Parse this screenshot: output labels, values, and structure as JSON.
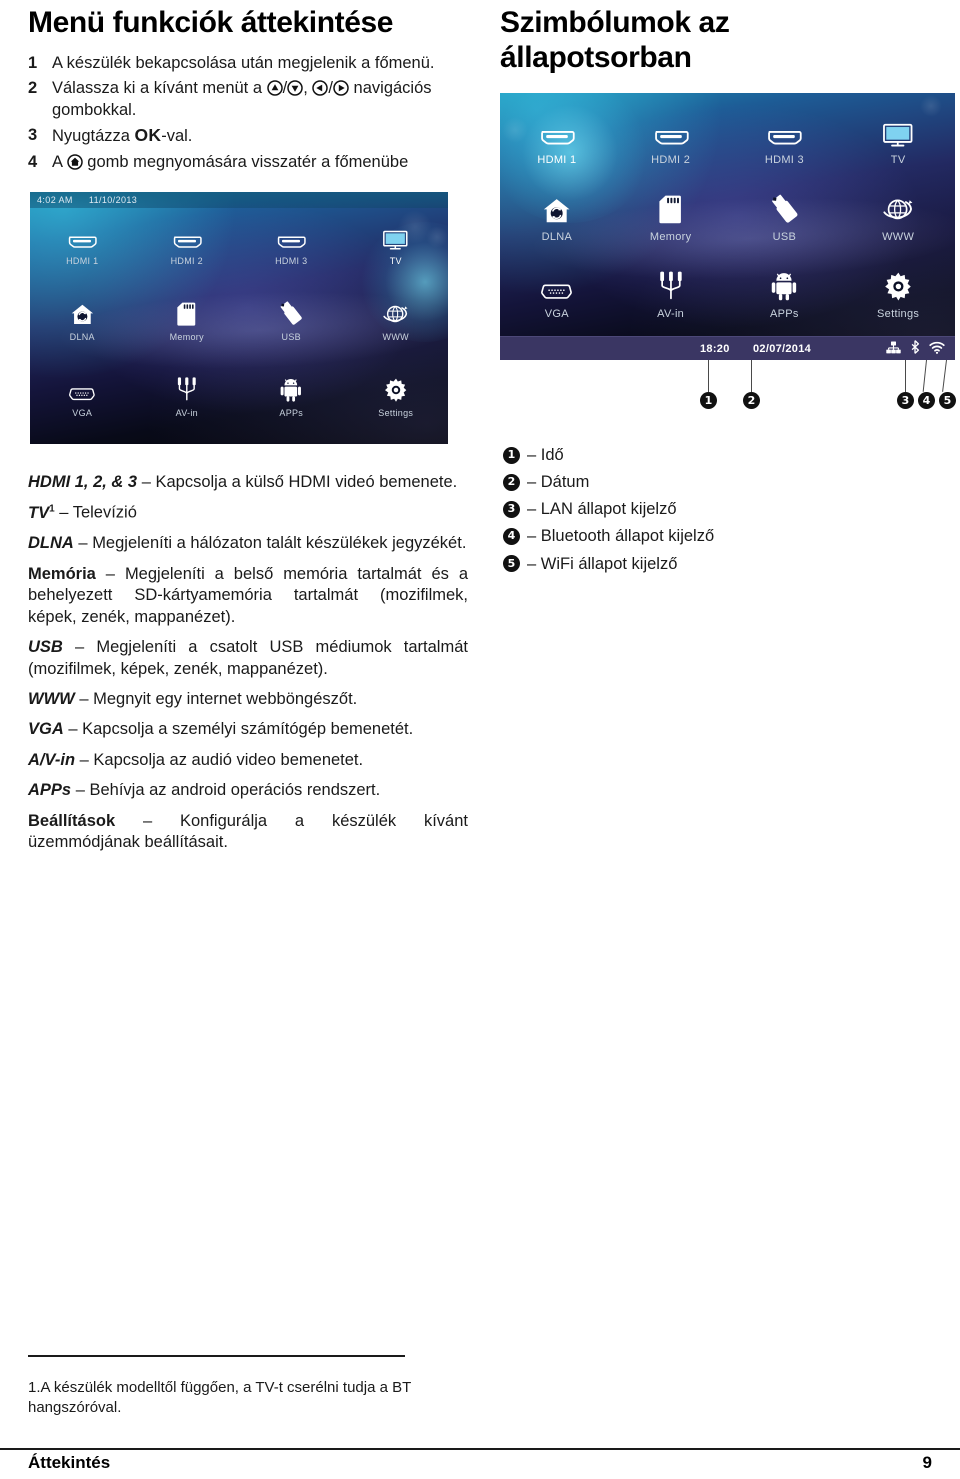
{
  "left_column": {
    "title": "Menü funkciók áttekintése",
    "steps": [
      {
        "num": "1",
        "text_before": "A készülék bekapcsolása után megjelenik a főmenü.",
        "icons": []
      },
      {
        "num": "2",
        "part1": "Válassza ki a kívánt menüt a ",
        "sep1": "/",
        "sep2": ", ",
        "sep3": "/",
        "part2": " navigációs gombokkal.",
        "icons": [
          "arrow-up-button-icon",
          "arrow-down-button-icon",
          "arrow-left-button-icon",
          "arrow-right-button-icon"
        ]
      },
      {
        "num": "3",
        "part1": "Nyugtázza ",
        "bold": "OK",
        "part2": "-val."
      },
      {
        "num": "4",
        "part1": "A ",
        "part2": " gomb megnyomására visszatér a főmenübe",
        "icons": [
          "home-button-icon"
        ]
      }
    ],
    "screenshot": {
      "name": "projector-main-menu-screenshot-left",
      "status_time": "4:02 AM",
      "status_date": "11/10/2013",
      "active_tile": "TV",
      "tiles": [
        {
          "label": "HDMI 1",
          "icon": "hdmi-port-icon"
        },
        {
          "label": "HDMI 2",
          "icon": "hdmi-port-icon"
        },
        {
          "label": "HDMI 3",
          "icon": "hdmi-port-icon"
        },
        {
          "label": "TV",
          "icon": "television-icon"
        },
        {
          "label": "DLNA",
          "icon": "dlna-house-share-icon"
        },
        {
          "label": "Memory",
          "icon": "sd-card-icon"
        },
        {
          "label": "USB",
          "icon": "usb-stick-icon"
        },
        {
          "label": "WWW",
          "icon": "globe-browser-icon"
        },
        {
          "label": "VGA",
          "icon": "vga-port-icon"
        },
        {
          "label": "AV-in",
          "icon": "av-cable-icon"
        },
        {
          "label": "APPs",
          "icon": "android-robot-icon"
        },
        {
          "label": "Settings",
          "icon": "gear-icon"
        }
      ]
    },
    "body": [
      {
        "term": "HDMI 1, 2, & 3",
        "style": "bold-italic",
        "sup": "",
        "dash": " – ",
        "text": "Kapcsolja a külső HDMI videó bemenete."
      },
      {
        "term": "TV",
        "style": "bold-italic",
        "sup": "1",
        "dash": " – ",
        "text": "Televízió"
      },
      {
        "term": "DLNA",
        "style": "bold-italic",
        "sup": "",
        "dash": " – ",
        "text": "Megjeleníti a hálózaton talált készülékek jegyzékét."
      },
      {
        "term": "Memória",
        "style": "bold",
        "sup": "",
        "dash": " – ",
        "text": "Megjeleníti a belső memória tartalmát és a behelyezett SD-kártyamemória tartalmát (mozifilmek, képek, zenék, mappanézet)."
      },
      {
        "term": "USB",
        "style": "bold-italic",
        "sup": "",
        "dash": " – ",
        "text": "Megjeleníti a csatolt USB médiumok tartalmát (mozifilmek, képek, zenék, mappanézet)."
      },
      {
        "term": "WWW",
        "style": "bold-italic",
        "sup": "",
        "dash": " – ",
        "text": "Megnyit egy internet webböngészőt."
      },
      {
        "term": "VGA",
        "style": "bold-italic",
        "sup": "",
        "dash": " – ",
        "text": "Kapcsolja a személyi számítógép bemenetét."
      },
      {
        "term": "A/V-in",
        "style": "bold-italic",
        "sup": "",
        "dash": " – ",
        "text": "Kapcsolja az audió video bemenetet."
      },
      {
        "term": "APPs",
        "style": "bold-italic",
        "sup": "",
        "dash": " – ",
        "text": "Behívja az android operációs rendszert."
      },
      {
        "term": "Beállítások",
        "style": "bold",
        "sup": "",
        "dash": " – ",
        "text": "Konfigurálja a készülék kívánt üzemmódjának beállításait."
      }
    ]
  },
  "right_column": {
    "title": "Szimbólumok az állapotsorban",
    "screenshot": {
      "name": "projector-main-menu-screenshot-right",
      "status_time": "18:20",
      "status_date": "02/07/2014",
      "active_tile": "HDMI 1",
      "status_icons": [
        "lan-status-icon",
        "bluetooth-status-icon",
        "wifi-status-icon"
      ],
      "tiles": [
        {
          "label": "HDMI 1",
          "icon": "hdmi-port-icon"
        },
        {
          "label": "HDMI 2",
          "icon": "hdmi-port-icon"
        },
        {
          "label": "HDMI 3",
          "icon": "hdmi-port-icon"
        },
        {
          "label": "TV",
          "icon": "television-icon"
        },
        {
          "label": "DLNA",
          "icon": "dlna-house-share-icon"
        },
        {
          "label": "Memory",
          "icon": "sd-card-icon"
        },
        {
          "label": "USB",
          "icon": "usb-stick-icon"
        },
        {
          "label": "WWW",
          "icon": "globe-browser-icon"
        },
        {
          "label": "VGA",
          "icon": "vga-port-icon"
        },
        {
          "label": "AV-in",
          "icon": "av-cable-icon"
        },
        {
          "label": "APPs",
          "icon": "android-robot-icon"
        },
        {
          "label": "Settings",
          "icon": "gear-icon"
        }
      ]
    },
    "callout_numbers": [
      "1",
      "2",
      "3",
      "4",
      "5"
    ],
    "legend": [
      {
        "num": "1",
        "text": "– Idő"
      },
      {
        "num": "2",
        "text": "– Dátum"
      },
      {
        "num": "3",
        "text": "– LAN állapot kijelző"
      },
      {
        "num": "4",
        "text": "– Bluetooth állapot kijelző"
      },
      {
        "num": "5",
        "text": "– WiFi állapot kijelző"
      }
    ]
  },
  "footnote": "1.A készülék modelltől függően, a TV-t cserélni tudja a BT hangszóróval.",
  "footer": {
    "left": "Áttekintés",
    "right": "9"
  },
  "colors": {
    "ink": "#1a1a1a",
    "statusbar_right": "#3a3663",
    "statusbar_left": "#126078",
    "tile_label": "#c9d3de"
  }
}
